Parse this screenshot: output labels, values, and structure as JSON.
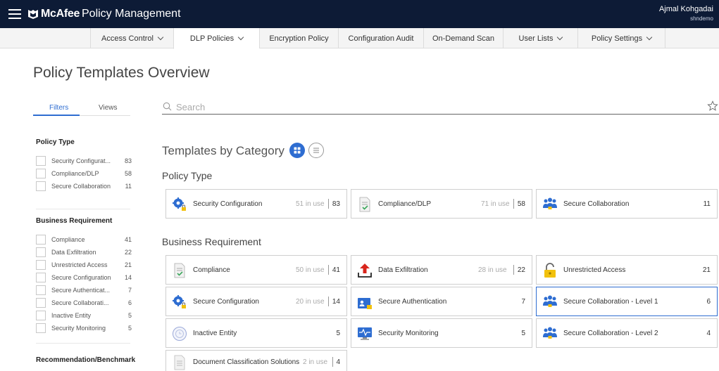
{
  "header": {
    "logo_text": "McAfee",
    "app_title": "Policy Management",
    "user_name": "Ajmal Kohgadai",
    "user_tenant": "shndemo"
  },
  "nav": {
    "tabs": [
      {
        "label": "Access Control",
        "dropdown": true
      },
      {
        "label": "DLP Policies",
        "dropdown": true,
        "active": true
      },
      {
        "label": "Encryption Policy",
        "dropdown": false
      },
      {
        "label": "Configuration Audit",
        "dropdown": false
      },
      {
        "label": "On-Demand Scan",
        "dropdown": false
      },
      {
        "label": "User Lists",
        "dropdown": true
      },
      {
        "label": "Policy Settings",
        "dropdown": true
      }
    ]
  },
  "page": {
    "title": "Policy Templates Overview"
  },
  "sidebar": {
    "tabs": {
      "filters": "Filters",
      "views": "Views"
    },
    "groups": [
      {
        "title": "Policy Type",
        "items": [
          {
            "label": "Security Configurat...",
            "count": "83"
          },
          {
            "label": "Compliance/DLP",
            "count": "58"
          },
          {
            "label": "Secure Collaboration",
            "count": "11"
          }
        ]
      },
      {
        "title": "Business Requirement",
        "items": [
          {
            "label": "Compliance",
            "count": "41"
          },
          {
            "label": "Data Exfiltration",
            "count": "22"
          },
          {
            "label": "Unrestricted Access",
            "count": "21"
          },
          {
            "label": "Secure Configuration",
            "count": "14"
          },
          {
            "label": "Secure Authenticat...",
            "count": "7"
          },
          {
            "label": "Secure Collaborati...",
            "count": "6"
          },
          {
            "label": "Inactive Entity",
            "count": "5"
          },
          {
            "label": "Security Monitoring",
            "count": "5"
          }
        ]
      },
      {
        "title": "Recommendation/Benchmark",
        "items": []
      }
    ]
  },
  "search": {
    "placeholder": "Search",
    "value": ""
  },
  "main": {
    "title": "Templates by Category",
    "sections": [
      {
        "title": "Policy Type",
        "cards": [
          {
            "label": "Security Configuration",
            "in_use": "51 in use",
            "count": "83",
            "icon": "gear-lock-icon"
          },
          {
            "label": "Compliance/DLP",
            "in_use": "71 in use",
            "count": "58",
            "icon": "document-check-icon"
          },
          {
            "label": "Secure Collaboration",
            "in_use": "",
            "count": "11",
            "icon": "people-group-icon"
          }
        ]
      },
      {
        "title": "Business Requirement",
        "cards": [
          {
            "label": "Compliance",
            "in_use": "50 in use",
            "count": "41",
            "icon": "document-check-icon"
          },
          {
            "label": "Data Exfiltration",
            "in_use": "28 in use",
            "count": "22",
            "icon": "upload-arrow-icon"
          },
          {
            "label": "Unrestricted Access",
            "in_use": "",
            "count": "21",
            "icon": "unlocked-padlock-icon"
          },
          {
            "label": "Secure Configuration",
            "in_use": "20 in use",
            "count": "14",
            "icon": "gear-lock-icon"
          },
          {
            "label": "Secure Authentication",
            "in_use": "",
            "count": "7",
            "icon": "id-card-lock-icon"
          },
          {
            "label": "Secure Collaboration - Level 1",
            "in_use": "",
            "count": "6",
            "icon": "people-group-icon",
            "selected": true
          },
          {
            "label": "Inactive Entity",
            "in_use": "",
            "count": "5",
            "icon": "clock-circle-icon"
          },
          {
            "label": "Security Monitoring",
            "in_use": "",
            "count": "5",
            "icon": "monitor-pulse-icon"
          },
          {
            "label": "Secure Collaboration - Level 2",
            "in_use": "",
            "count": "4",
            "icon": "people-group-icon"
          },
          {
            "label": "Document Classification Solutions",
            "in_use": "2 in use",
            "count": "4",
            "icon": "document-list-icon"
          }
        ]
      }
    ]
  },
  "colors": {
    "topbar": "#0d1b36",
    "accent": "#2e6dd1",
    "card_border": "#cfcfcf",
    "muted_text": "#aaaaaa"
  }
}
